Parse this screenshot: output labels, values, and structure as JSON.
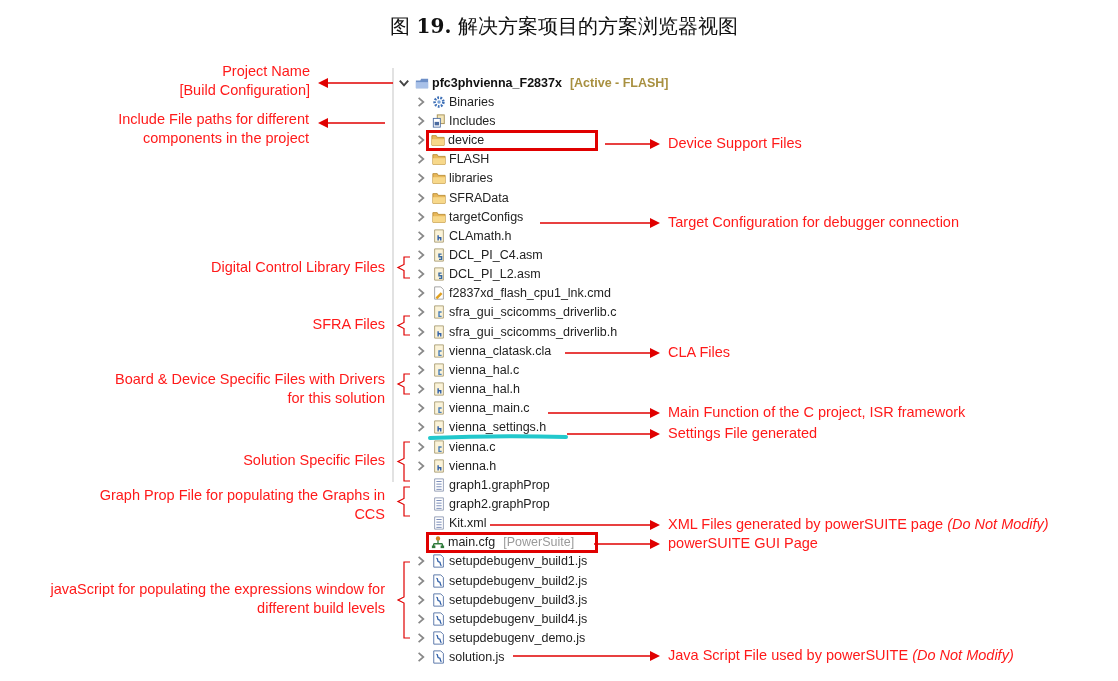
{
  "figure_title": "图 **19.** 解决方案项目的方案浏览器视图",
  "tree": {
    "label": "pfc3phvienna_F2837x",
    "decoration": "[Active - FLASH]",
    "kind": "project",
    "expanded": true,
    "highlighted": false,
    "underlined": false,
    "children": [
      {
        "label": "Binaries",
        "kind": "binaries",
        "expanded": false,
        "highlighted": false,
        "underlined": false
      },
      {
        "label": "Includes",
        "kind": "includes",
        "expanded": false,
        "highlighted": false,
        "underlined": false
      },
      {
        "label": "device",
        "kind": "folder",
        "expanded": false,
        "highlighted": true,
        "underlined": false
      },
      {
        "label": "FLASH",
        "kind": "folder",
        "expanded": false,
        "highlighted": false,
        "underlined": false
      },
      {
        "label": "libraries",
        "kind": "folder",
        "expanded": false,
        "highlighted": false,
        "underlined": false
      },
      {
        "label": "SFRAData",
        "kind": "folder",
        "expanded": false,
        "highlighted": false,
        "underlined": false
      },
      {
        "label": "targetConfigs",
        "kind": "folder",
        "expanded": false,
        "highlighted": false,
        "underlined": false
      },
      {
        "label": "CLAmath.h",
        "kind": "h",
        "expanded": false,
        "highlighted": false,
        "underlined": false
      },
      {
        "label": "DCL_PI_C4.asm",
        "kind": "s",
        "expanded": false,
        "highlighted": false,
        "underlined": false
      },
      {
        "label": "DCL_PI_L2.asm",
        "kind": "s",
        "expanded": false,
        "highlighted": false,
        "underlined": false
      },
      {
        "label": "f2837xd_flash_cpu1_lnk.cmd",
        "kind": "cmd",
        "expanded": false,
        "highlighted": false,
        "underlined": false
      },
      {
        "label": "sfra_gui_scicomms_driverlib.c",
        "kind": "c",
        "expanded": false,
        "highlighted": false,
        "underlined": false
      },
      {
        "label": "sfra_gui_scicomms_driverlib.h",
        "kind": "h",
        "expanded": false,
        "highlighted": false,
        "underlined": false
      },
      {
        "label": "vienna_clatask.cla",
        "kind": "c",
        "expanded": false,
        "highlighted": false,
        "underlined": false
      },
      {
        "label": "vienna_hal.c",
        "kind": "c",
        "expanded": false,
        "highlighted": false,
        "underlined": false
      },
      {
        "label": "vienna_hal.h",
        "kind": "h",
        "expanded": false,
        "highlighted": false,
        "underlined": false
      },
      {
        "label": "vienna_main.c",
        "kind": "c",
        "expanded": false,
        "highlighted": false,
        "underlined": false
      },
      {
        "label": "vienna_settings.h",
        "kind": "h",
        "expanded": false,
        "highlighted": false,
        "underlined": true
      },
      {
        "label": "vienna.c",
        "kind": "c",
        "expanded": false,
        "highlighted": false,
        "underlined": false
      },
      {
        "label": "vienna.h",
        "kind": "h",
        "expanded": false,
        "highlighted": false,
        "underlined": false
      },
      {
        "label": "graph1.graphProp",
        "kind": "doc",
        "highlighted": false,
        "underlined": false
      },
      {
        "label": "graph2.graphProp",
        "kind": "doc",
        "highlighted": false,
        "underlined": false
      },
      {
        "label": "Kit.xml",
        "kind": "doc",
        "highlighted": false,
        "underlined": false
      },
      {
        "label": "main.cfg",
        "decoration": "[PowerSuite]",
        "kind": "cfg",
        "highlighted": true,
        "underlined": false
      },
      {
        "label": "setupdebugenv_build1.js",
        "kind": "js",
        "expanded": false,
        "highlighted": false,
        "underlined": false
      },
      {
        "label": "setupdebugenv_build2.js",
        "kind": "js",
        "expanded": false,
        "highlighted": false,
        "underlined": false
      },
      {
        "label": "setupdebugenv_build3.js",
        "kind": "js",
        "expanded": false,
        "highlighted": false,
        "underlined": false
      },
      {
        "label": "setupdebugenv_build4.js",
        "kind": "js",
        "expanded": false,
        "highlighted": false,
        "underlined": false
      },
      {
        "label": "setupdebugenv_demo.js",
        "kind": "js",
        "expanded": false,
        "highlighted": false,
        "underlined": false
      },
      {
        "label": "solution.js",
        "kind": "js",
        "expanded": false,
        "highlighted": false,
        "underlined": false
      }
    ]
  },
  "left_annotations": [
    {
      "text": "Project Name\n[Build Configuration]",
      "kind": "arrow"
    },
    {
      "text": "Include File paths for different\ncomponents in the project",
      "kind": "arrow"
    },
    {
      "text": "Digital Control Library Files",
      "kind": "brace"
    },
    {
      "text": "SFRA Files",
      "kind": "brace"
    },
    {
      "text": "Board & Device Specific Files with Drivers\nfor this solution",
      "kind": "brace"
    },
    {
      "text": "Solution Specific Files",
      "kind": "brace"
    },
    {
      "text": "Graph Prop File for populating the Graphs in\nCCS",
      "kind": "brace"
    },
    {
      "text": "javaScript for populating the expressions window for\ndifferent build levels",
      "kind": "brace"
    }
  ],
  "right_annotations": [
    {
      "text": "Device Support Files"
    },
    {
      "text": "Target Configuration for debugger connection"
    },
    {
      "text": "CLA Files"
    },
    {
      "text": "Main Function of the C project, ISR framework"
    },
    {
      "text": "Settings File generated"
    },
    {
      "text": "XML Files generated by powerSUITE page *(Do Not Modify)*"
    },
    {
      "text": "powerSUITE GUI Page"
    },
    {
      "text": "Java Script File used by powerSUITE *(Do Not Modify)*"
    }
  ]
}
